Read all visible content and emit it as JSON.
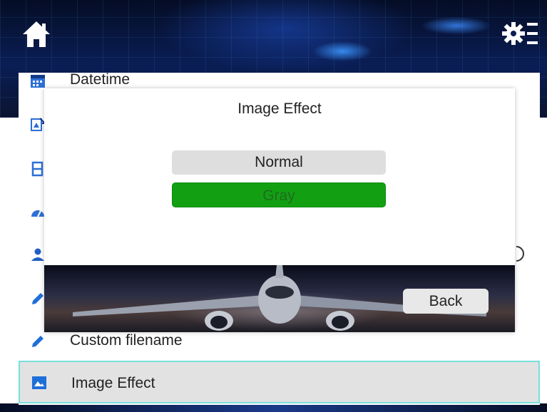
{
  "header": {
    "home_icon": "home-icon",
    "settings_icon": "settings-gear-icon"
  },
  "settings_list": {
    "items": [
      {
        "label": "Datetime",
        "icon": "calendar-icon"
      },
      {
        "label": "",
        "icon": "image-rotate-icon"
      },
      {
        "label": "",
        "icon": "film-icon"
      },
      {
        "label": "",
        "icon": "gauge-icon"
      },
      {
        "label": "",
        "icon": "person-icon"
      },
      {
        "label": "",
        "icon": "pencil-icon"
      },
      {
        "label": "Custom filename",
        "icon": "pencil-icon"
      },
      {
        "label": "Image Effect",
        "icon": "picture-icon",
        "selected": true
      }
    ]
  },
  "dialog": {
    "title": "Image Effect",
    "options": [
      {
        "label": "Normal",
        "selected": false
      },
      {
        "label": "Gray",
        "selected": true
      }
    ],
    "back_label": "Back"
  },
  "colors": {
    "accent_blue": "#1e6fd9",
    "selected_option": "#12a012",
    "selected_row_border": "#77e0dc"
  }
}
